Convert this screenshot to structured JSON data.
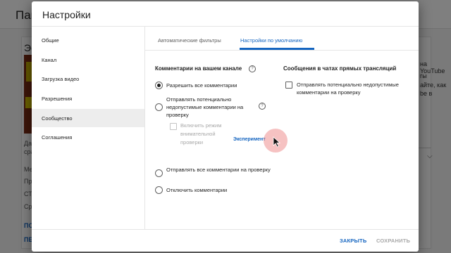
{
  "background": {
    "page_title": "Пан",
    "section_heading": "Эф",
    "left_lines": [
      "Дан",
      "сра",
      "Мес",
      "Про",
      "СТ",
      "Сре"
    ],
    "links": [
      "ПО",
      "ПЕ"
    ],
    "right_lines": [
      "на YouTube",
      "гы",
      "айте, как",
      "be в"
    ]
  },
  "dialog": {
    "title": "Настройки",
    "nav": [
      {
        "label": "Общие",
        "active": false
      },
      {
        "label": "Канал",
        "active": false
      },
      {
        "label": "Загрузка видео",
        "active": false
      },
      {
        "label": "Разрешения",
        "active": false
      },
      {
        "label": "Сообщество",
        "active": true
      },
      {
        "label": "Соглашения",
        "active": false
      }
    ],
    "tabs": [
      {
        "label": "Автоматические фильтры",
        "active": false
      },
      {
        "label": "Настройки по умолчанию",
        "active": true
      }
    ],
    "comments": {
      "title": "Комментарии на вашем канале",
      "options": [
        {
          "label": "Разрешить все комментарии",
          "selected": true
        },
        {
          "label": "Отправлять потенциально недопустимые комментарии на проверку",
          "selected": false
        },
        {
          "label": "Отправлять все комментарии на проверку",
          "selected": false
        },
        {
          "label": "Отключить комментарии",
          "selected": false
        }
      ],
      "sub_option": {
        "label": "Включить режим внимательной проверки",
        "checked": false,
        "disabled": true,
        "badge": "Эксперимент"
      }
    },
    "live_chat": {
      "title": "Сообщения в чатах прямых трансляций",
      "option": {
        "label": "Отправлять потенциально недопустимые комментарии на проверку",
        "checked": false
      }
    },
    "buttons": {
      "close": "ЗАКРЫТЬ",
      "save": "СОХРАНИТЬ"
    }
  },
  "colors": {
    "accent": "#1565c0",
    "disabled": "#a8a8a8",
    "nav_active_bg": "#ededed"
  }
}
